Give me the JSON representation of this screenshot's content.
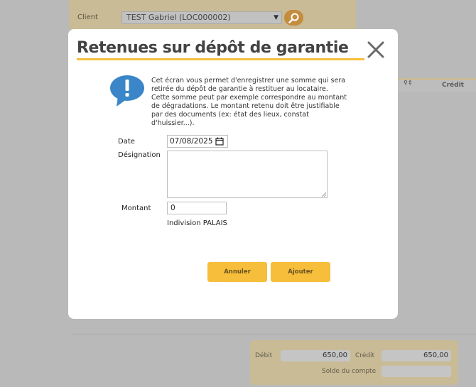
{
  "background": {
    "client_label": "Client",
    "client_value": "TEST Gabriel (LOC000002)",
    "table_header_credit": "Crédit",
    "totals": {
      "debit_label": "Débit",
      "debit_value": "650,00",
      "credit_label": "Crédit",
      "credit_value": "650,00",
      "solde_label": "Solde du compte",
      "solde_value": ""
    }
  },
  "modal": {
    "title": "Retenues sur dépôt de garantie",
    "info_text": "Cet écran vous permet d'enregistrer une somme qui sera retirée du dépôt de garantie à restituer au locataire. Cette somme peut par exemple correspondre au montant de dégradations. Le montant retenu doit être justifiable par des documents (ex: état des lieux, constat d'huissier...).",
    "form": {
      "date_label": "Date",
      "date_value": "07/08/2025",
      "designation_label": "Désignation",
      "designation_value": "",
      "montant_label": "Montant",
      "montant_value": "0",
      "owner": "Indivision PALAIS"
    },
    "buttons": {
      "cancel": "Annuler",
      "add": "Ajouter"
    }
  },
  "colors": {
    "accent": "#f6be3b",
    "title": "#434343",
    "info_icon": "#3a86c8",
    "overlay_panel": "#c9bb95"
  }
}
